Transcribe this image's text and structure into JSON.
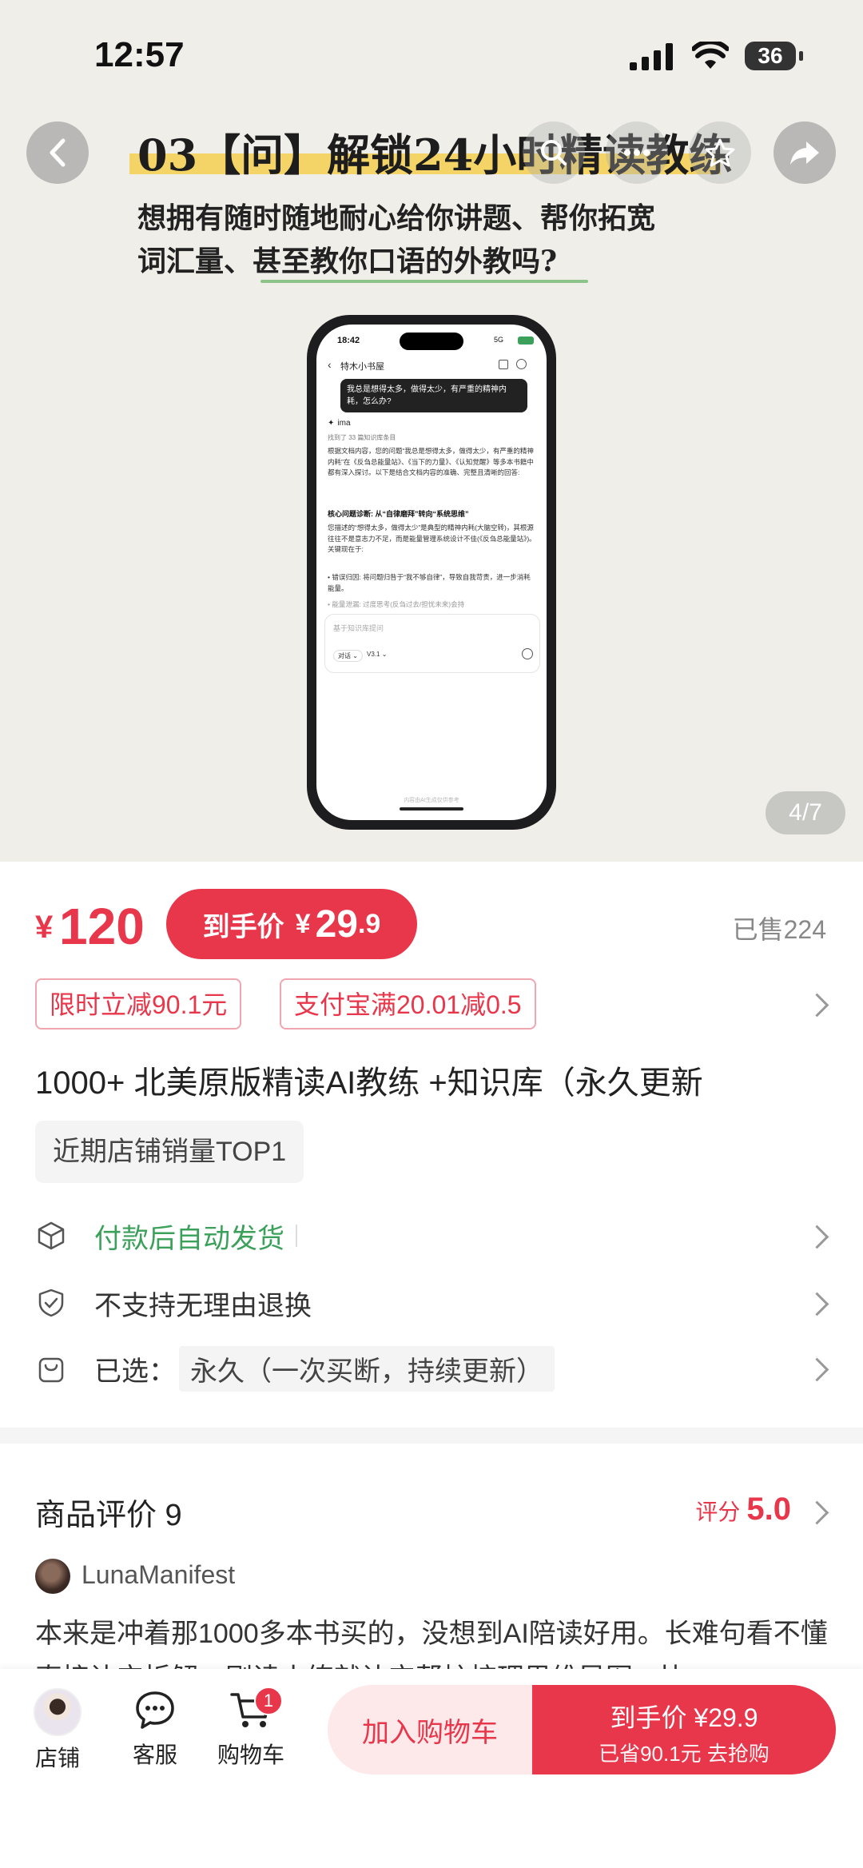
{
  "status": {
    "time": "12:57",
    "battery": "36"
  },
  "hero": {
    "title": "03【问】解锁24小时精读教练",
    "subtitle_line1": "想拥有随时随地耐心给你讲题、帮你拓宽",
    "subtitle_line2": "词汇量、甚至教你口语的外教吗?",
    "page_indicator": "4/7",
    "phone": {
      "time": "18:42",
      "network": "5G",
      "header": "特木小书屋",
      "user_msg": "我总是想得太多，做得太少，有严重的精神内耗，怎么办?",
      "bot_name": "ima",
      "ref_note": "找到了 33 篇知识库条目",
      "p1": "根据文档内容，您的问题“我总是想得太多，做得太少，有严重的精神内耗”在《反刍总能量站》、《当下的力量》、《认知觉醒》等多本书籍中都有深入探讨。以下是结合文档内容的准确、完整且清晰的回答:",
      "p2_title": "核心问题诊断: 从“自律磨拜”转向“系统思维”",
      "p2": "您描述的“想得太多，做得太少”是典型的精神内耗(大脑空转)，其根源往往不是意志力不足，而是能量管理系统设计不佳(《反刍总能量站》)。关键现在于:",
      "b1": "错误归因: 将问题归咎于“我不够自律”，导致自我苛责，进一步消耗能量。",
      "b2": "能量泄漏: 过度思考(反刍过去/担忧未来)会持",
      "input_placeholder": "基于知识库提问",
      "mode": "对话",
      "version": "V3.1",
      "footer": "内容由AI生成仅供参考"
    }
  },
  "price": {
    "currency": "¥",
    "original": "120",
    "final_label": "到手价",
    "final_currency": "¥",
    "final_int": "29",
    "final_dec": ".9",
    "sold": "已售224"
  },
  "tags": [
    "限时立减90.1元",
    "支付宝满20.01减0.5"
  ],
  "product_name": "1000+ 北美原版精读AI教练 +知识库（永久更新",
  "rank_badge": "近期店铺销量TOP1",
  "rows": {
    "delivery": "付款后自动发货",
    "returns": "不支持无理由退换",
    "selected_label": "已选：",
    "selected_value": "永久（一次买断，持续更新）"
  },
  "review": {
    "title": "商品评价 9",
    "score_label": "评分",
    "score": "5.0",
    "username": "LunaManifest",
    "text": "本来是冲着那1000多本书买的，没想到AI陪读好用。长难句看不懂直接让它拆解，刚读小练就让它帮忙梳理思维导图，比"
  },
  "bottom": {
    "shop": "店铺",
    "service": "客服",
    "cart": "购物车",
    "cart_count": "1",
    "add_cart": "加入购物车",
    "buy_label": "到手价",
    "buy_currency": "¥",
    "buy_price": "29.9",
    "buy_sub": "已省90.1元 去抢购"
  },
  "colors": {
    "accent": "#e8364b",
    "green": "#3aa05a",
    "highlight": "#f4d466"
  }
}
